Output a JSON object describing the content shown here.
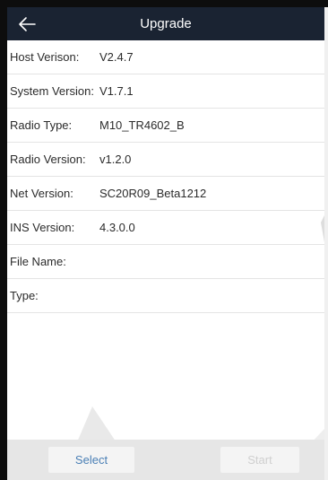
{
  "header": {
    "title": "Upgrade",
    "back_icon": "arrow-left-icon"
  },
  "info": [
    {
      "label": "Host Verison:",
      "value": "V2.4.7"
    },
    {
      "label": "System Version:",
      "value": "V1.7.1"
    },
    {
      "label": "Radio Type:",
      "value": "M10_TR4602_B"
    },
    {
      "label": "Radio Version:",
      "value": "v1.2.0"
    },
    {
      "label": "Net Version:",
      "value": "SC20R09_Beta1212"
    },
    {
      "label": "INS Version:",
      "value": "4.3.0.0"
    },
    {
      "label": "File Name:",
      "value": ""
    },
    {
      "label": "Type:",
      "value": ""
    }
  ],
  "buttons": {
    "select_label": "Select",
    "start_label": "Start"
  },
  "colors": {
    "header_bg": "#1a2332",
    "select_text": "#4a7fb5",
    "start_text_disabled": "#cfcfcf"
  }
}
